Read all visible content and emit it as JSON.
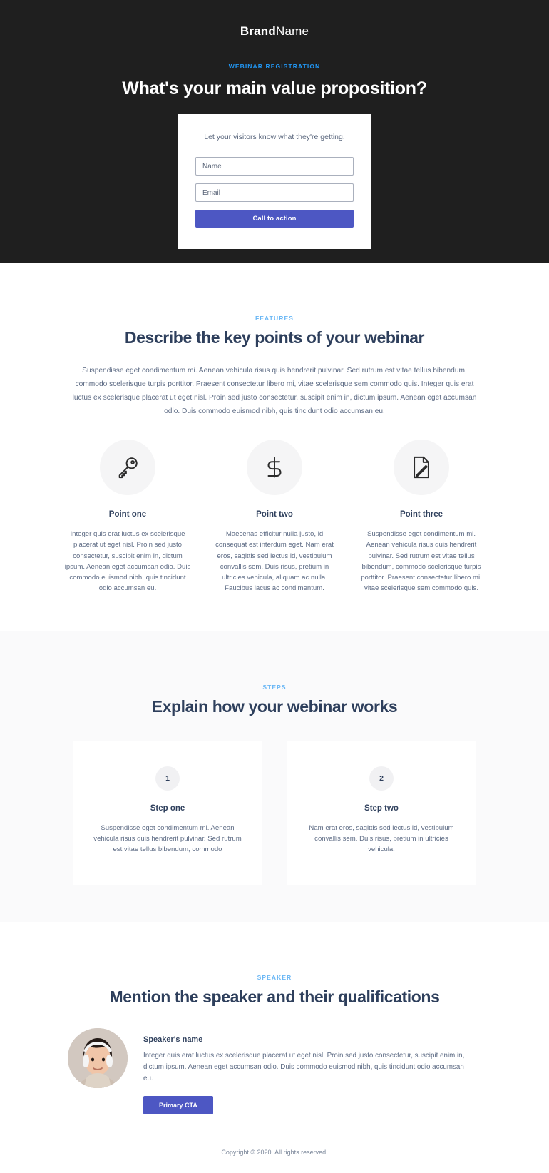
{
  "colors": {
    "hero_bg": "#1f1f1f",
    "accent_blue": "#2196f3",
    "accent_blue_light": "#6ab7f5",
    "button_indigo": "#4d57c3",
    "heading_navy": "#2e3f5c",
    "body_text": "#5d6b84",
    "steps_bg": "#fafafb",
    "icon_circle": "#f5f5f6"
  },
  "hero": {
    "brand_strong": "Brand",
    "brand_light": "Name",
    "eyebrow": "WEBINAR REGISTRATION",
    "title": "What's your main value proposition?",
    "form": {
      "lead": "Let your visitors know what they're getting.",
      "name_placeholder": "Name",
      "name_value": "",
      "email_placeholder": "Email",
      "email_value": "",
      "submit_label": "Call to action"
    }
  },
  "features": {
    "eyebrow": "FEATURES",
    "heading": "Describe the key points of your webinar",
    "lead": "Suspendisse eget condimentum mi. Aenean vehicula risus quis hendrerit pulvinar. Sed rutrum est vitae tellus bibendum, commodo scelerisque turpis porttitor. Praesent consectetur libero mi, vitae scelerisque sem commodo quis. Integer quis erat luctus ex scelerisque placerat ut eget nisl. Proin sed justo consectetur, suscipit enim in, dictum ipsum. Aenean eget accumsan odio. Duis commodo euismod nibh, quis tincidunt odio accumsan eu.",
    "items": [
      {
        "icon": "key-icon",
        "title": "Point one",
        "text": "Integer quis erat luctus ex scelerisque placerat ut eget nisl. Proin sed justo consectetur, suscipit enim in, dictum ipsum. Aenean eget accumsan odio. Duis commodo euismod nibh, quis tincidunt odio accumsan eu."
      },
      {
        "icon": "dollar-sign-icon",
        "title": "Point two",
        "text": "Maecenas efficitur nulla justo, id consequat est interdum eget. Nam erat eros, sagittis sed lectus id, vestibulum convallis sem. Duis risus, pretium in ultricies vehicula, aliquam ac nulla. Faucibus lacus ac condimentum."
      },
      {
        "icon": "document-edit-icon",
        "title": "Point three",
        "text": "Suspendisse eget condimentum mi. Aenean vehicula risus quis hendrerit pulvinar. Sed rutrum est vitae tellus bibendum, commodo scelerisque turpis porttitor. Praesent consectetur libero mi, vitae scelerisque sem commodo quis."
      }
    ]
  },
  "steps": {
    "eyebrow": "STEPS",
    "heading": "Explain how your webinar works",
    "items": [
      {
        "number": "1",
        "title": "Step one",
        "text": "Suspendisse eget condimentum mi. Aenean vehicula risus quis hendrerit pulvinar. Sed rutrum est vitae tellus bibendum, commodo"
      },
      {
        "number": "2",
        "title": "Step two",
        "text": "Nam erat eros, sagittis sed lectus id, vestibulum convallis sem. Duis risus, pretium in ultricies vehicula."
      }
    ]
  },
  "speaker": {
    "eyebrow": "SPEAKER",
    "heading": "Mention the speaker and their qualifications",
    "avatar_alt": "speaker-portrait",
    "name": "Speaker's name",
    "bio": "Integer quis erat luctus ex scelerisque placerat ut eget nisl. Proin sed justo consectetur, suscipit enim in, dictum ipsum. Aenean eget accumsan odio. Duis commodo euismod nibh, quis tincidunt odio accumsan eu.",
    "cta_label": "Primary CTA"
  },
  "footer": {
    "copyright": "Copyright © 2020. All rights reserved."
  }
}
